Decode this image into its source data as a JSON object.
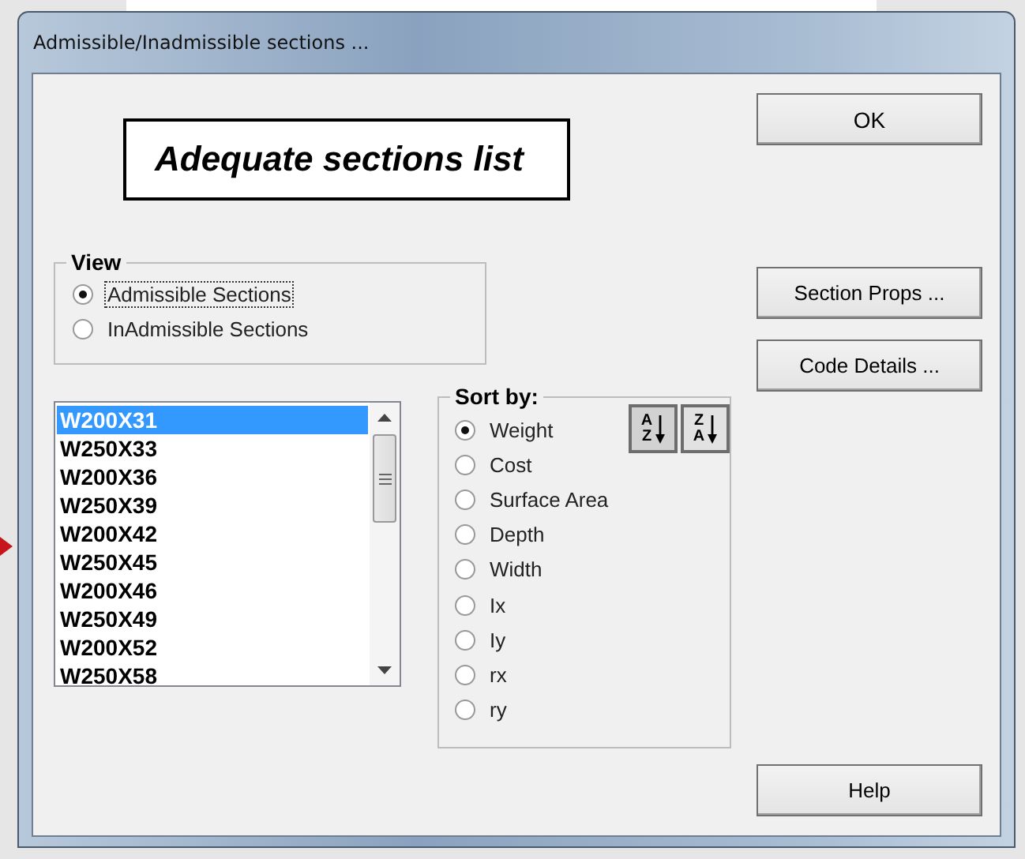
{
  "window": {
    "title": "Admissible/Inadmissible sections ..."
  },
  "annotation": "Adequate sections list",
  "ok_button": {
    "label": "OK"
  },
  "view": {
    "label": "View",
    "options": [
      {
        "label": "Admissible Sections",
        "selected": true,
        "focused": true
      },
      {
        "label": "InAdmissible Sections",
        "selected": false,
        "focused": false
      }
    ]
  },
  "side_buttons": [
    {
      "label": "Section Props ..."
    },
    {
      "label": "Code Details ..."
    }
  ],
  "sections": [
    {
      "label": "W200X31",
      "selected": true
    },
    {
      "label": "W250X33",
      "selected": false
    },
    {
      "label": "W200X36",
      "selected": false
    },
    {
      "label": "W250X39",
      "selected": false
    },
    {
      "label": "W200X42",
      "selected": false
    },
    {
      "label": "W250X45",
      "selected": false
    },
    {
      "label": "W200X46",
      "selected": false
    },
    {
      "label": "W250X49",
      "selected": false
    },
    {
      "label": "W200X52",
      "selected": false
    },
    {
      "label": "W250X58",
      "selected": false
    }
  ],
  "sort": {
    "label": "Sort by:",
    "order_buttons": [
      {
        "kind": "ascending",
        "top": "A",
        "bottom": "Z"
      },
      {
        "kind": "descending",
        "top": "Z",
        "bottom": "A"
      }
    ],
    "options": [
      {
        "label": "Weight",
        "selected": true
      },
      {
        "label": "Cost",
        "selected": false
      },
      {
        "label": "Surface Area",
        "selected": false
      },
      {
        "label": "Depth",
        "selected": false
      },
      {
        "label": "Width",
        "selected": false
      },
      {
        "label": "Ix",
        "selected": false
      },
      {
        "label": "Iy",
        "selected": false
      },
      {
        "label": "rx",
        "selected": false
      },
      {
        "label": "ry",
        "selected": false
      }
    ]
  },
  "help_button": {
    "label": "Help"
  }
}
